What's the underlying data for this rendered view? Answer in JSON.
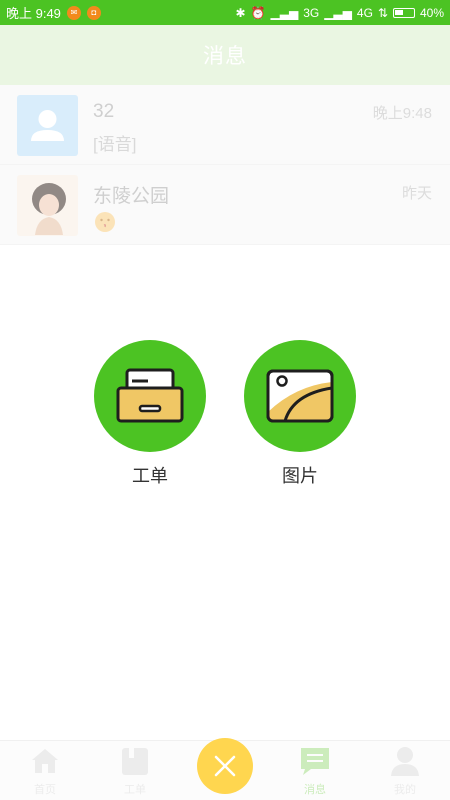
{
  "status_bar": {
    "time": "晚上 9:49",
    "network1": "3G",
    "network2": "4G",
    "battery": "40%"
  },
  "header": {
    "title": "消息"
  },
  "conversations": [
    {
      "name": "32",
      "message": "[语音]",
      "time": "晚上9:48",
      "avatar": "default-user-icon"
    },
    {
      "name": "东陵公园",
      "message": "",
      "time": "昨天",
      "avatar": "girl-photo"
    }
  ],
  "actions": [
    {
      "label": "工单",
      "icon": "inbox-tray-icon"
    },
    {
      "label": "图片",
      "icon": "image-icon"
    }
  ],
  "tabs": [
    {
      "label": "首页",
      "icon": "home-icon"
    },
    {
      "label": "工单",
      "icon": "document-icon"
    },
    {
      "label": "消息",
      "icon": "chat-icon"
    },
    {
      "label": "我的",
      "icon": "user-icon"
    }
  ],
  "colors": {
    "brand_green": "#4cc323",
    "fab_yellow": "#ffd64f"
  }
}
